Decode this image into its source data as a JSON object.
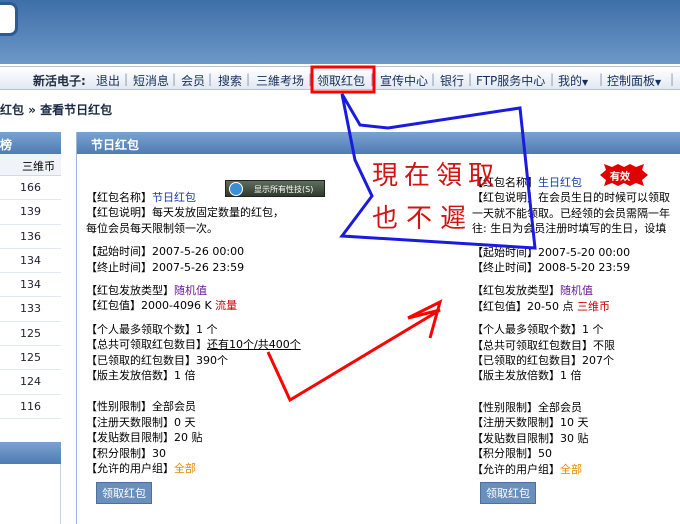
{
  "navbar": {
    "brand": "新活电子:",
    "items": [
      "退出",
      "短消息",
      "会员",
      "搜索",
      "三維考场",
      "领取红包",
      "宣传中心",
      "银行",
      "FTP服务中心",
      "我的",
      "控制面板"
    ]
  },
  "breadcrumb": "红包 » 查看节日红包",
  "sidebar": {
    "title": "榜",
    "column": "三维币",
    "values": [
      "166",
      "139",
      "136",
      "134",
      "134",
      "133",
      "125",
      "125",
      "124",
      "116"
    ]
  },
  "main": {
    "title": "节日红包",
    "left": {
      "name_label": "【红包名称】",
      "name_value": "节日红包",
      "desc_label": "【红包说明】",
      "desc_value": "每天发放固定数量的红包，",
      "desc_value2": "每位会员每天限制领一次。",
      "start_label": "【起始时间】",
      "start_value": "2007-5-26 00:00",
      "end_label": "【终止时间】",
      "end_value": "2007-5-26 23:59",
      "type_label": "【红包发放类型】",
      "type_value": "随机值",
      "value_label": "【红包值】",
      "value_value": "2000-4096 K",
      "value_unit": "流量",
      "max_label": "【个人最多领取个数】",
      "max_value": "1 个",
      "total_label": "【总共可领取红包数目】",
      "total_value": "还有10个/共400个",
      "got_label": "【已领取的红包数目】",
      "got_value": "390个",
      "mult_label": "【版主发放倍数】",
      "mult_value": "1 倍",
      "sex_label": "【性别限制】",
      "sex_value": "全部会员",
      "days_label": "【注册天数限制】",
      "days_value": "0 天",
      "posts_label": "【发贴数目限制】",
      "posts_value": "20 贴",
      "score_label": "【积分限制】",
      "score_value": "30",
      "group_label": "【允许的用户组】",
      "group_value": "全部",
      "button": "领取红包"
    },
    "right": {
      "name_label": "【红包名称】",
      "name_value": "生日红包",
      "desc_label": "【红包说明】",
      "desc_value": "在会员生日的时候可以领取",
      "desc_value2": "一天就不能领取。已经领的会员需隔一年",
      "desc_value3": "往: 生日为会员注册时填写的生日，设填",
      "start_label": "【起始时间】",
      "start_value": "2007-5-20 00:00",
      "end_label": "【终止时间】",
      "end_value": "2008-5-20 23:59",
      "type_label": "【红包发放类型】",
      "type_value": "随机值",
      "value_label": "【红包值】",
      "value_value": "20-50 点",
      "value_unit": "三维币",
      "max_label": "【个人最多领取个数】",
      "max_value": "1 个",
      "total_label": "【总共可领取红包数目】",
      "total_value": "不限",
      "got_label": "【已领取的红包数目】",
      "got_value": "207个",
      "mult_label": "【版主发放倍数】",
      "mult_value": "1 倍",
      "sex_label": "【性别限制】",
      "sex_value": "全部会员",
      "days_label": "【注册天数限制】",
      "days_value": "10 天",
      "posts_label": "【发贴数目限制】",
      "posts_value": "30 贴",
      "score_label": "【积分限制】",
      "score_value": "50",
      "group_label": "【允许的用户组】",
      "group_value": "全部",
      "button": "领取红包",
      "badge": "有效"
    }
  },
  "tooltip": "显示所有性技(S)",
  "annotation": {
    "line1": "現在領取",
    "line2": "也不遲",
    "colors": {
      "highlight": "#ff0000",
      "callout": "#1a1ae0",
      "text": "#d21414"
    }
  }
}
